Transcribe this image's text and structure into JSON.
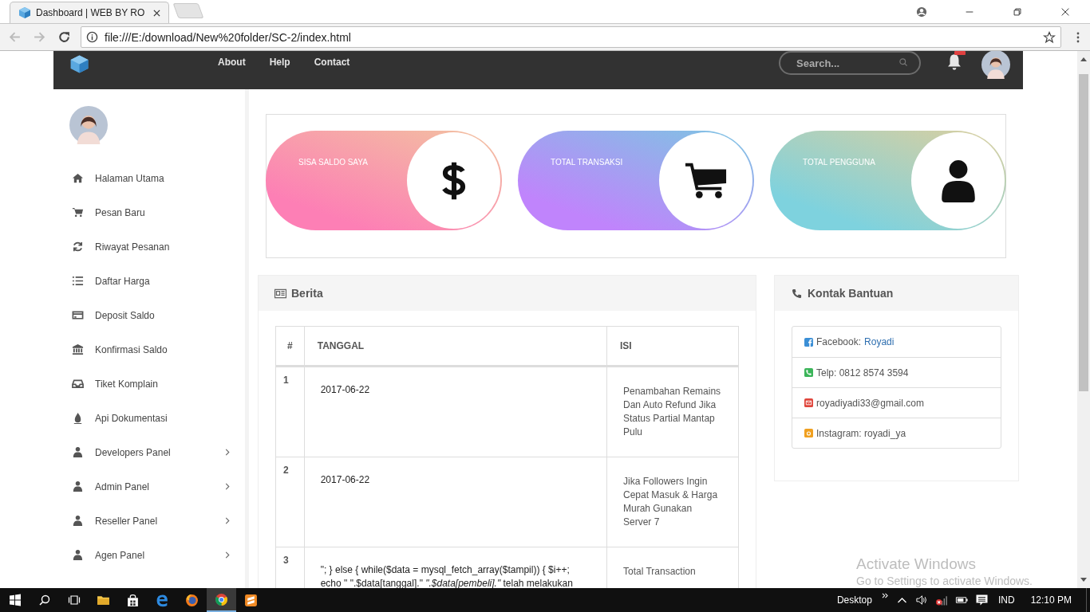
{
  "browser": {
    "tab_title": "Dashboard | WEB BY RO",
    "url": "file:///E:/download/New%20folder/SC-2/index.html"
  },
  "navbar": {
    "links": [
      "About",
      "Help",
      "Contact"
    ],
    "search": {
      "placeholder": "Search..."
    }
  },
  "sidebar": {
    "items": [
      {
        "label": "Halaman Utama",
        "has_submenu": false
      },
      {
        "label": "Pesan Baru",
        "has_submenu": false
      },
      {
        "label": "Riwayat Pesanan",
        "has_submenu": false
      },
      {
        "label": "Daftar Harga",
        "has_submenu": false
      },
      {
        "label": "Deposit Saldo",
        "has_submenu": false
      },
      {
        "label": "Konfirmasi Saldo",
        "has_submenu": false
      },
      {
        "label": "Tiket Komplain",
        "has_submenu": false
      },
      {
        "label": "Api Dokumentasi",
        "has_submenu": false
      },
      {
        "label": "Developers Panel",
        "has_submenu": true
      },
      {
        "label": "Admin Panel",
        "has_submenu": true
      },
      {
        "label": "Reseller Panel",
        "has_submenu": true
      },
      {
        "label": "Agen Panel",
        "has_submenu": true
      }
    ]
  },
  "stats": [
    {
      "label": "SISA SALDO SAYA"
    },
    {
      "label": "TOTAL TRANSAKSI"
    },
    {
      "label": "TOTAL PENGGUNA"
    }
  ],
  "berita": {
    "title": "Berita",
    "columns": [
      "#",
      "TANGGAL",
      "ISI"
    ],
    "rows": [
      {
        "no": "1",
        "tanggal": "2017-06-22",
        "isi": "Penambahan Remains Dan Auto Refund Jika Status Partial Mantap Pulu"
      },
      {
        "no": "2",
        "tanggal": "2017-06-22",
        "isi": "Jika Followers Ingin Cepat Masuk & Harga Murah Gunakan Server 7"
      },
      {
        "no": "3",
        "tanggal": "\"; } else { while($data = mysql_fetch_array($tampil)) { $i++; echo \" \".$data[tanggal].\" *\".$data[pembeli].\"* telah melakukan",
        "isi": "Total Transaction"
      }
    ]
  },
  "kontak": {
    "title": "Kontak Bantuan",
    "items": [
      {
        "kind": "facebook",
        "text": "Facebook:",
        "link": "Royadi"
      },
      {
        "kind": "phone",
        "text": "Telp: 0812 8574 3594"
      },
      {
        "kind": "email",
        "text": "royadiyadi33@gmail.com"
      },
      {
        "kind": "instagram",
        "text": "Instagram: royadi_ya"
      }
    ]
  },
  "activation": {
    "title": "Activate Windows",
    "subtitle": "Go to Settings to activate Windows."
  },
  "taskbar": {
    "apps": [
      {
        "selected": false
      },
      {
        "selected": false
      },
      {
        "selected": false
      },
      {
        "selected": false
      },
      {
        "selected": true
      },
      {
        "selected": false
      }
    ],
    "desktop": "Desktop",
    "language": "IND",
    "time": "12:10 PM"
  }
}
